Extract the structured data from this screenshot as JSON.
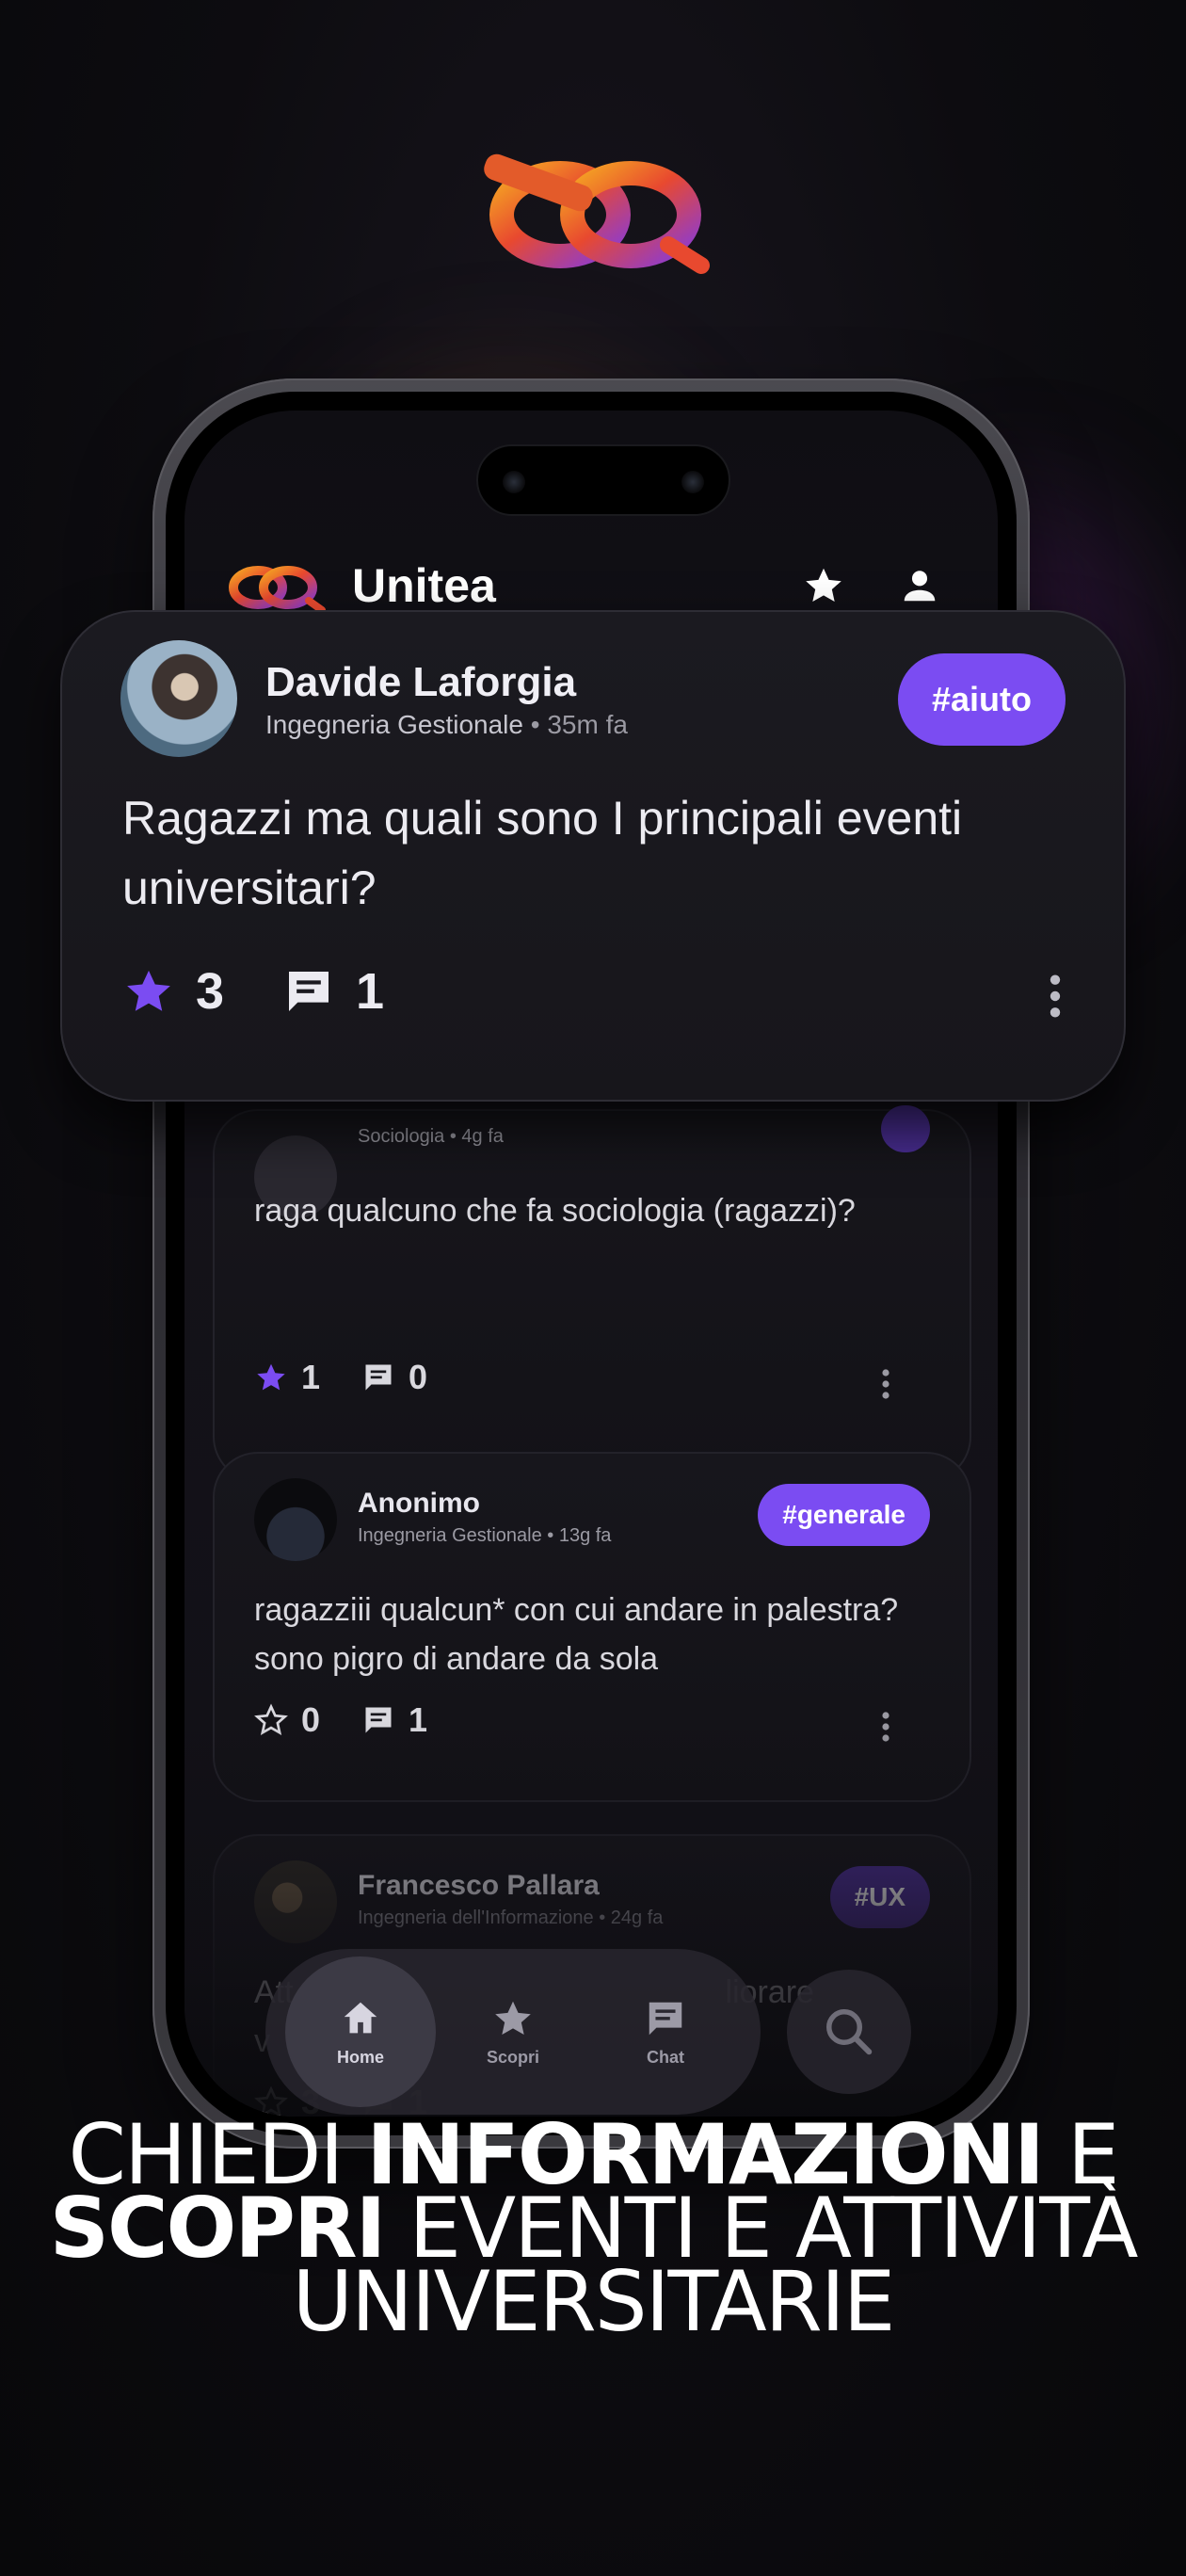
{
  "app": {
    "title": "Unitea"
  },
  "header": {
    "star_icon": "star-icon",
    "profile_icon": "person-icon"
  },
  "featured_post": {
    "author": "Davide Laforgia",
    "faculty": "Ingegneria Gestionale",
    "separator": " • ",
    "time": "35m fa",
    "tag": "#aiuto",
    "text": "Ragazzi ma quali sono I principali eventi universitari?",
    "stars": "3",
    "comments": "1"
  },
  "posts": [
    {
      "faculty": "Sociologia",
      "time": "4g fa",
      "text": "raga qualcuno che fa sociologia (ragazzi)?",
      "stars": "1",
      "comments": "0"
    },
    {
      "author": "Anonimo",
      "faculty": "Ingegneria Gestionale",
      "time": "13g fa",
      "tag": "#generale",
      "text": "ragazziii qualcun* con cui andare in palestra? sono pigro di andare da sola",
      "stars": "0",
      "comments": "1"
    },
    {
      "author": "Francesco Pallara",
      "faculty": "Ingegneria dell'Informazione",
      "time": "24g fa",
      "tag": "#UX",
      "text_fragment_1": "Att",
      "text_fragment_2": "liorare",
      "text_fragment_3": "v",
      "stars": "3",
      "comments": "1"
    }
  ],
  "bottom_nav": {
    "items": [
      {
        "label": "Home",
        "icon": "home-icon",
        "active": true
      },
      {
        "label": "Scopri",
        "icon": "star-icon",
        "active": false
      },
      {
        "label": "Chat",
        "icon": "chat-icon",
        "active": false
      }
    ],
    "search_icon": "search-icon"
  },
  "headline": {
    "line1_light": "CHIEDI ",
    "line1_bold": "INFORMAZIONI",
    "line1_end": " E",
    "line2_bold": "SCOPRI",
    "line2_light": " EVENTI E ATTIVITÀ",
    "line3_light": "UNIVERSITARIE"
  },
  "colors": {
    "accent": "#7b4cf2",
    "background": "#0d0c10"
  }
}
